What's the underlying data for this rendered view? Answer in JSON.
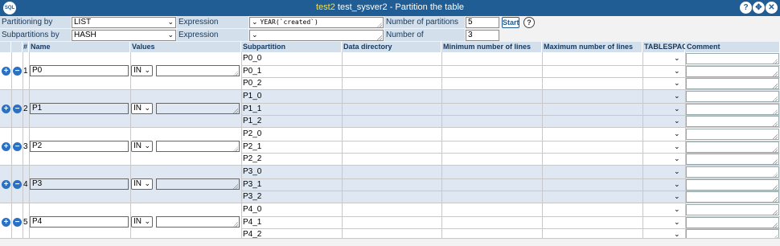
{
  "titlebar": {
    "logo_text": "SQL",
    "db_name": "test2",
    "title_rest": "test_sysver2 - Partition the table",
    "help_icon": "?",
    "maximize_icon": "✥",
    "close_icon": "✕"
  },
  "options": {
    "partitioning_label": "Partitioning by",
    "partitioning_value": "LIST",
    "expression_label": "Expression",
    "expression_value": "YEAR(`created`)",
    "num_partitions_label": "Number of partitions",
    "num_partitions_value": "5",
    "start_label": "Start",
    "subpartitioning_label": "Subpartitions by",
    "subpartitioning_value": "HASH",
    "sub_expression_label": "Expression",
    "sub_expression_value": "",
    "num_subpartitions_label": "Number of subpartitions",
    "num_subpartitions_value": "3"
  },
  "columns": {
    "num": "#",
    "name": "Name",
    "values": "Values",
    "subpartition": "Subpartition",
    "data_directory": "Data directory",
    "min_lines": "Minimum number of lines",
    "max_lines": "Maximum number of lines",
    "tablespace": "TABLESPACE",
    "comment": "Comment"
  },
  "partitions": [
    {
      "num": "1",
      "name": "P0",
      "op": "IN",
      "subs": [
        "P0_0",
        "P0_1",
        "P0_2"
      ]
    },
    {
      "num": "2",
      "name": "P1",
      "op": "IN",
      "subs": [
        "P1_0",
        "P1_1",
        "P1_2"
      ]
    },
    {
      "num": "3",
      "name": "P2",
      "op": "IN",
      "subs": [
        "P2_0",
        "P2_1",
        "P2_2"
      ]
    },
    {
      "num": "4",
      "name": "P3",
      "op": "IN",
      "subs": [
        "P3_0",
        "P3_1",
        "P3_2"
      ]
    },
    {
      "num": "5",
      "name": "P4",
      "op": "IN",
      "subs": [
        "P4_0",
        "P4_1",
        "P4_2"
      ]
    }
  ],
  "icons": {
    "add": "+",
    "remove": "−",
    "dropdown": "⌄"
  },
  "colors": {
    "titlebar": "#1f5d94",
    "db_name": "#f5e148",
    "header": "#d3dfeb",
    "band_even": "#dfe8f2"
  }
}
